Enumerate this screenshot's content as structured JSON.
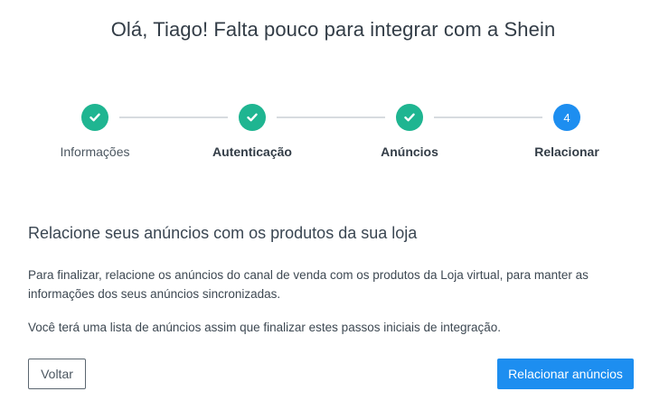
{
  "title": "Olá, Tiago! Falta pouco para integrar com a Shein",
  "stepper": {
    "steps": [
      {
        "label": "Informações",
        "status": "done",
        "icon": "check-icon"
      },
      {
        "label": "Autenticação",
        "status": "done",
        "icon": "check-icon"
      },
      {
        "label": "Anúncios",
        "status": "done",
        "icon": "check-icon"
      },
      {
        "label": "Relacionar",
        "status": "current",
        "number": "4"
      }
    ]
  },
  "content": {
    "heading": "Relacione seus anúncios com os produtos da sua loja",
    "paragraph1": "Para finalizar, relacione os anúncios do canal de venda com os produtos da Loja virtual, para manter as informações dos seus anúncios sincronizadas.",
    "paragraph2": "Você terá uma lista de anúncios assim que finalizar estes passos iniciais de integração."
  },
  "actions": {
    "back_label": "Voltar",
    "primary_label": "Relacionar anúncios"
  },
  "colors": {
    "done": "#1fb591",
    "current": "#1d8ef0",
    "primary_button": "#1d8ef0",
    "connector": "#d7dbdf"
  }
}
